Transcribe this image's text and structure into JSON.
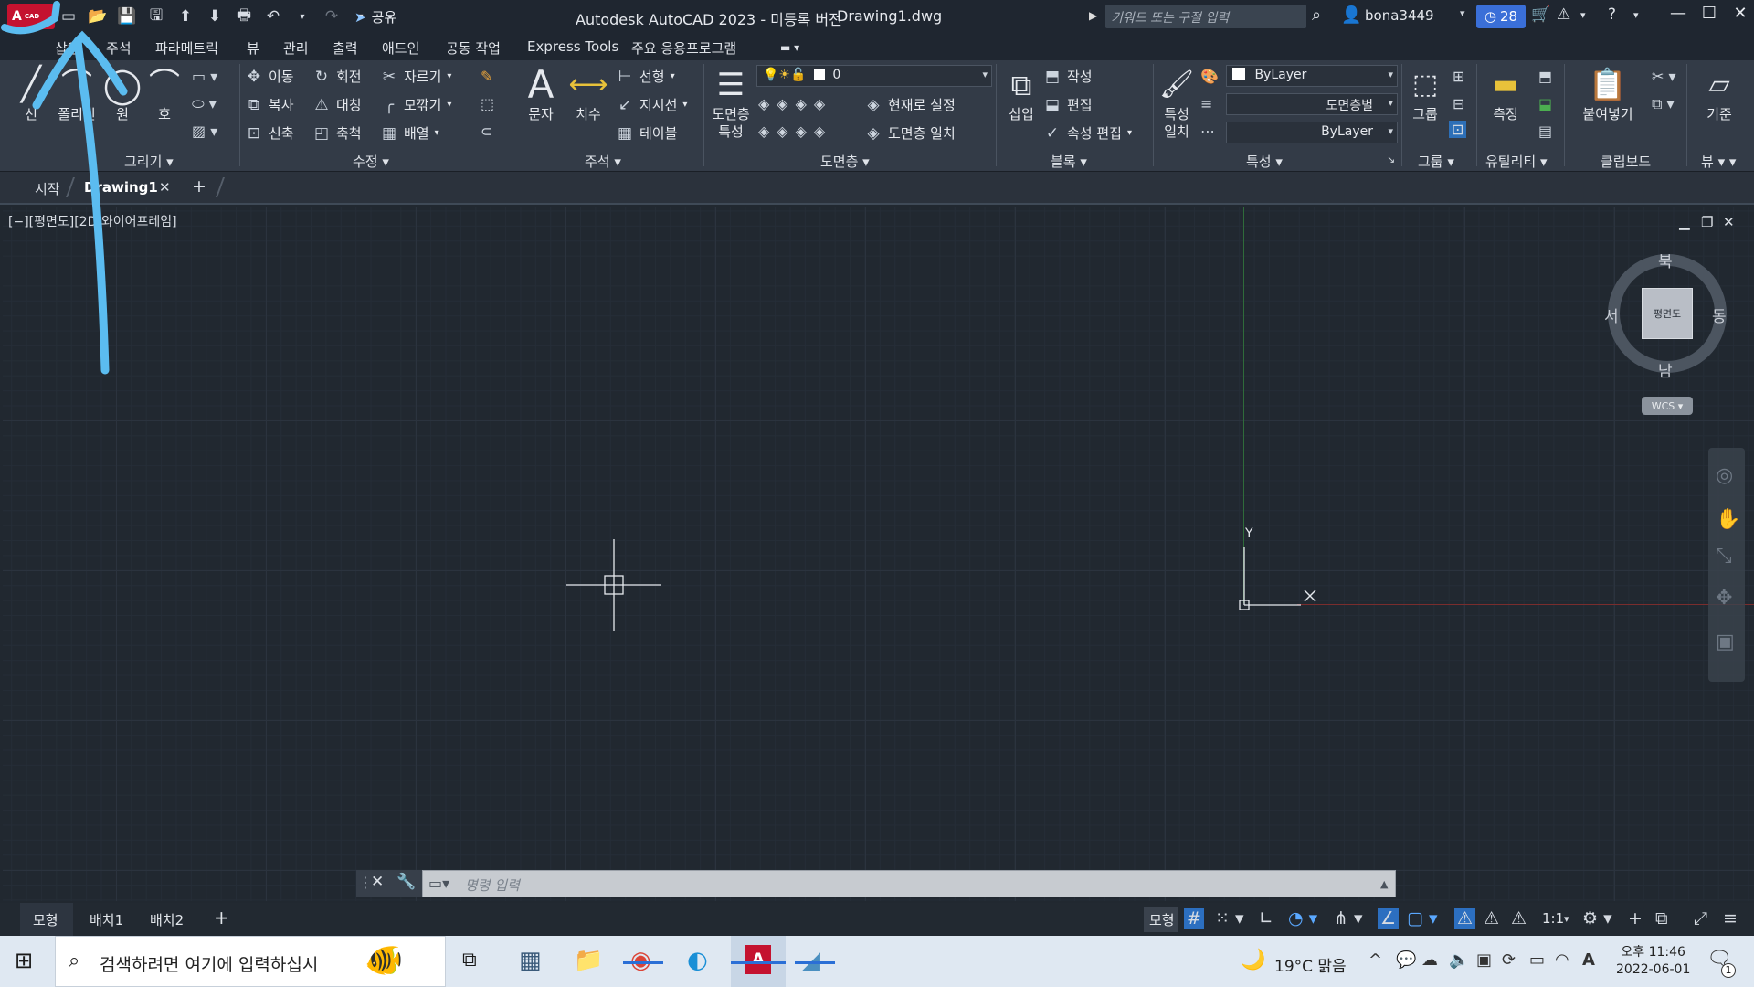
{
  "titlebar": {
    "logo": "A",
    "logo_sub": "CAD",
    "share": "공유",
    "title": "Autodesk AutoCAD 2023 - 미등록 버전",
    "file": "Drawing1.dwg",
    "search_placeholder": "키워드 또는 구절 입력",
    "user": "bona3449",
    "trial_days": "28"
  },
  "ribbon_tabs": [
    "삽입",
    "주석",
    "파라메트릭",
    "뷰",
    "관리",
    "출력",
    "애드인",
    "공동 작업",
    "Express Tools",
    "주요 응용프로그램"
  ],
  "ribbon": {
    "draw": {
      "title": "그리기",
      "line": "선",
      "polyline": "폴리선",
      "circle": "원",
      "arc": "호"
    },
    "modify": {
      "title": "수정",
      "move": "이동",
      "rotate": "회전",
      "trim": "자르기",
      "copy": "복사",
      "mirror": "대칭",
      "fillet": "모깎기",
      "stretch": "신축",
      "scale": "축척",
      "array": "배열"
    },
    "annotation": {
      "title": "주석",
      "text": "문자",
      "dimension": "치수",
      "linear": "선형",
      "leader": "지시선",
      "table": "테이블"
    },
    "layers": {
      "title": "도면층",
      "properties_line1": "도면층",
      "properties_line2": "특성",
      "current_layer": "0",
      "make_current": "현재로 설정",
      "match_layer": "도면층 일치"
    },
    "block": {
      "title": "블록",
      "insert": "삽입",
      "create": "작성",
      "edit": "편집",
      "edit_attributes": "속성 편집"
    },
    "properties": {
      "title": "특성",
      "match_line1": "특성",
      "match_line2": "일치",
      "color": "ByLayer",
      "linetype": "도면층별",
      "lineweight": "ByLayer"
    },
    "groups": {
      "title": "그룹",
      "group": "그룹"
    },
    "utilities": {
      "title": "유틸리티",
      "measure": "측정"
    },
    "clipboard": {
      "title": "클립보드",
      "paste": "붙여넣기"
    },
    "view": {
      "title": "뷰",
      "base": "기준"
    }
  },
  "file_tabs": {
    "start": "시작",
    "drawing": "Drawing1"
  },
  "viewport": {
    "label": "[−][평면도][2D 와이어프레임]",
    "viewcube_face": "평면도",
    "north": "북",
    "south": "남",
    "east": "동",
    "west": "서",
    "wcs": "WCS",
    "y_label": "Y"
  },
  "command_line": {
    "placeholder": "명령 입력"
  },
  "layout_tabs": [
    "모형",
    "배치1",
    "배치2"
  ],
  "statusbar": {
    "model": "모형",
    "scale": "1:1"
  },
  "taskbar": {
    "search_placeholder": "검색하려면 여기에 입력하십시",
    "weather": "19°C 맑음",
    "time": "오후 11:46",
    "date": "2022-06-01",
    "notification_count": "1"
  },
  "colors": {
    "accent": "#3a6fd8",
    "annotation_stroke": "#5bbcf0",
    "autocad_red": "#c4122f"
  }
}
